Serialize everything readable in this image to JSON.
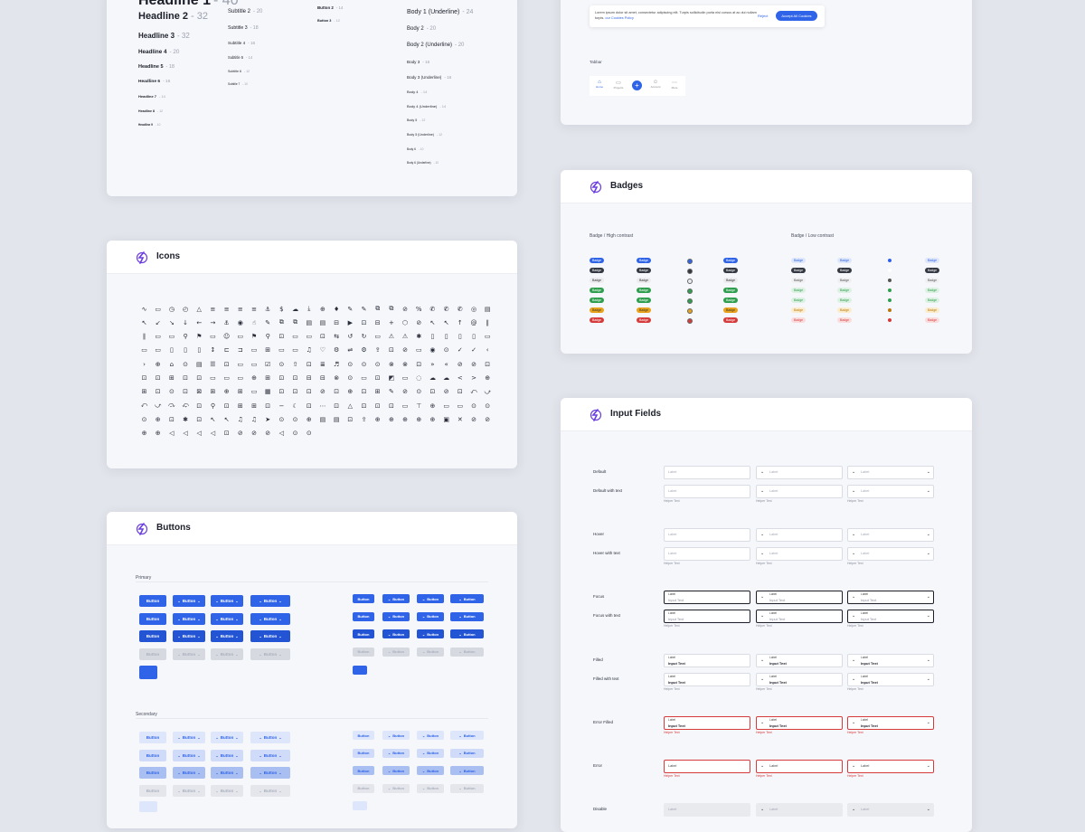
{
  "colors": {
    "primary": "#2f64e8",
    "primary_hover": "#2354d4",
    "primary_press": "#1b44b8",
    "disabled": "#d7d9e0",
    "secondary": "#dde6fb",
    "secondary_text": "#2f64e8",
    "accent_logo": "#6b3ee0",
    "error": "#d63b3b"
  },
  "typography": {
    "headlines": [
      {
        "name": "Headline 1",
        "size": "- 40"
      },
      {
        "name": "Headline 2",
        "size": "- 32"
      },
      {
        "name": "Headline 3",
        "size": "- 32"
      },
      {
        "name": "Headline 4",
        "size": "- 20"
      },
      {
        "name": "Headline 5",
        "size": "- 18"
      },
      {
        "name": "Headline 6",
        "size": "- 16"
      },
      {
        "name": "Headline 7",
        "size": "- 14"
      },
      {
        "name": "Headline 8",
        "size": "- 12"
      },
      {
        "name": "Headline 9",
        "size": "- 10"
      }
    ],
    "subtitles": [
      {
        "name": "Subtitle 2",
        "size": "- 20"
      },
      {
        "name": "Subtitle 3",
        "size": "- 18"
      },
      {
        "name": "Subtitle 4",
        "size": "- 16"
      },
      {
        "name": "Subtitle 5",
        "size": "- 14"
      },
      {
        "name": "Subtitle 6",
        "size": "- 12"
      },
      {
        "name": "Subtitle 7",
        "size": "- 10"
      }
    ],
    "buttons": [
      {
        "name": "Button 2",
        "size": "- 14"
      },
      {
        "name": "Button 3",
        "size": "- 12"
      }
    ],
    "bodies": [
      {
        "name": "Body 1 (Underline)",
        "size": "- 24"
      },
      {
        "name": "Body 2",
        "size": "- 20"
      },
      {
        "name": "Body 2 (Underline)",
        "size": "- 20"
      },
      {
        "name": "Body 3",
        "size": "- 16"
      },
      {
        "name": "Body 3 (Underline)",
        "size": "- 16"
      },
      {
        "name": "Body 4",
        "size": "- 14"
      },
      {
        "name": "Body 4 (Underline)",
        "size": "- 14"
      },
      {
        "name": "Body 5",
        "size": "- 12"
      },
      {
        "name": "Body 5 (Underline)",
        "size": "- 12"
      },
      {
        "name": "Body 6",
        "size": "- 10"
      },
      {
        "name": "Body 6 (Underline)",
        "size": "- 10"
      }
    ]
  },
  "cookies": {
    "text": "Lorem ipsum dolor sit amet, consectetur adipiscing elit. Turpis sollicitudin porta nisi cursus at ac dui nullam turpis.",
    "link": "our Cookies Policy",
    "reject": "Reject",
    "accept": "Accept All Cookies"
  },
  "tabbar": {
    "label": "Tabbar",
    "items": [
      {
        "label": "Home",
        "icon": "home-icon"
      },
      {
        "label": "Projects",
        "icon": "folder-icon"
      },
      {
        "label": "",
        "icon": "plus-icon"
      },
      {
        "label": "Account",
        "icon": "user-icon"
      },
      {
        "label": "More",
        "icon": "more-icon"
      }
    ]
  },
  "badges": {
    "title": "Badges",
    "high_label": "Badge / High contrast",
    "low_label": "Badge / Low contrast",
    "text": "Badge"
  },
  "icons": {
    "title": "Icons",
    "glyphs": "∿▭◷◴△≡≡≡≡⚓$☁⤓⊕♦✎✎⧉⧉⊘%✆✆✆◎▤↖↙↘↓←→⚓◉☝✎⧉⧉▤▤⊟▶⊡⊟+⬡⊘↖↖↑@∥∥▭▭⚲⚑▭☺▭⚑⚲⊡▭▭⊡⇆↺↻▭⚠⚠✱▯▯▯▯▭▭▭▯▯▯↕⊏⊐▭⊞▭▭♫♡⚙⇌⚙⇪⊡⊘▭◉⊙✓✓‹›⊕⌂⊙▤☰⊡▭▭☑⊙⇧⊡≣♬⊙⊙⊙⊗⊗⊡»«⊘⊘⊡⊡⊡⊞⊡⊡▭▭▭⊕⊞⊡⊡⊟⊟⊗⊙▭⊡◩▭◌☁☁<>⊕⊞⊡⊙⊡⊠⊞⊕⊞▭▦⊡⊡⊡⊘⊡⊕⊡⊞✎⊘⊙⊡⊘⊡⤺⤻⤺⤻⤼⤽⊡⚲⊡⊞⊞⊡−☾⊡⋯⊡△⊡⊡⊡▭⊤⊕▭▭⊙⊙⊙⊕⊡✱⊡↖↖♫♫➤⊙⊙⊕▤▤⊡⇪⊕⊕⊕⊕⊕▣✕⊘⊘⊕⊕◁◁◁◁⊡⊘⊘⊘◁⊙⊙"
  },
  "buttons": {
    "title": "Buttons",
    "primary_label": "Primary",
    "secondary_label": "Secondary",
    "label": "Button"
  },
  "inputs": {
    "title": "Input Fields",
    "label": "Label",
    "input_text": "Input Text",
    "helper": "Helper Text",
    "rows": [
      "Default",
      "Default with text",
      "Hover",
      "Hover with text",
      "Focus",
      "Focus with text",
      "Filled",
      "Filled with text",
      "Error Filled",
      "Error",
      "Disable"
    ]
  }
}
